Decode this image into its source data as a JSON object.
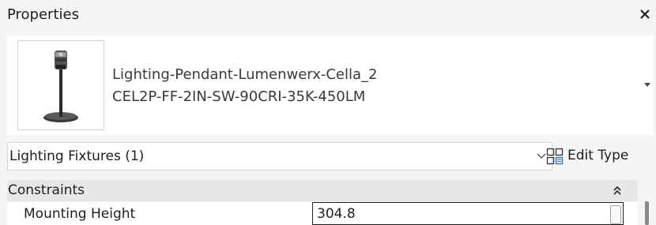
{
  "panel": {
    "title": "Properties",
    "close_glyph": "×"
  },
  "type_selector": {
    "family": "Lighting-Pendant-Lumenwerx-Cella_2",
    "type": "CEL2P-FF-2IN-SW-90CRI-35K-450LM",
    "thumbnail_icon": "pendant-light-icon"
  },
  "filter": {
    "selected": "Lighting Fixtures (1)"
  },
  "edit_type": {
    "label": "Edit Type",
    "icon": "edit-type-icon"
  },
  "groups": [
    {
      "label": "Constraints",
      "params": [
        {
          "label": "Mounting Height",
          "value": "304.8"
        }
      ]
    }
  ],
  "colors": {
    "panel_bg": "#f5f5f5",
    "group_header_bg": "#e7e7e7",
    "field_border": "#1e1e1e"
  }
}
